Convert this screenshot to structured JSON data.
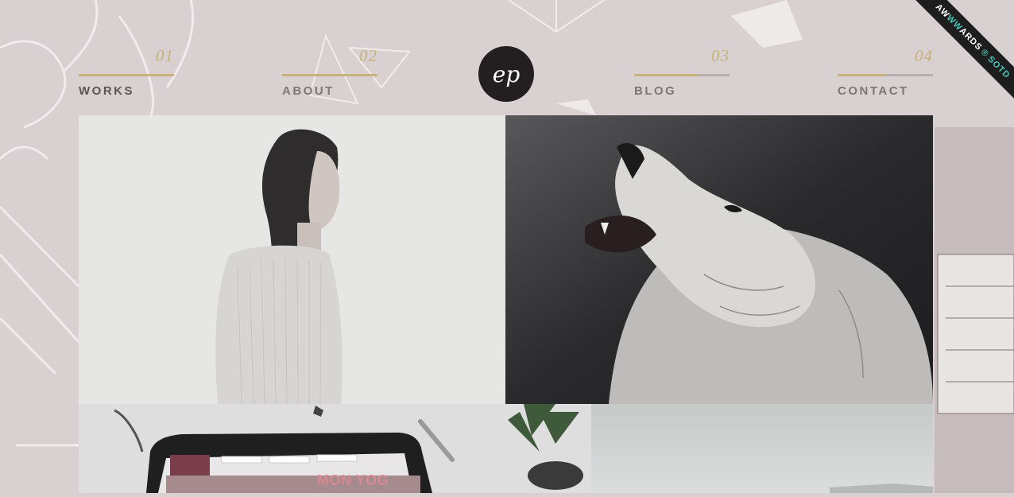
{
  "nav": {
    "works": {
      "num": "01",
      "label": "WORKS",
      "progress": 1.0
    },
    "about": {
      "num": "02",
      "label": "ABOUT",
      "progress": 1.0
    },
    "blog": {
      "num": "03",
      "label": "BLOG",
      "progress": 0.67
    },
    "contact": {
      "num": "04",
      "label": "CONTACT",
      "progress": 0.5
    }
  },
  "logo": {
    "text": "ep"
  },
  "ribbon": {
    "aw": "AW",
    "w": "WW",
    "ards": "ARDS",
    "reg": "®",
    "sotd": "SOTD"
  },
  "tiles": {
    "laptop_text": "MON YOG"
  },
  "colors": {
    "accent": "#c7b27a",
    "background": "#d9d0d2",
    "logo_bg": "#231f20",
    "awwwards_teal": "#49c5b6"
  }
}
